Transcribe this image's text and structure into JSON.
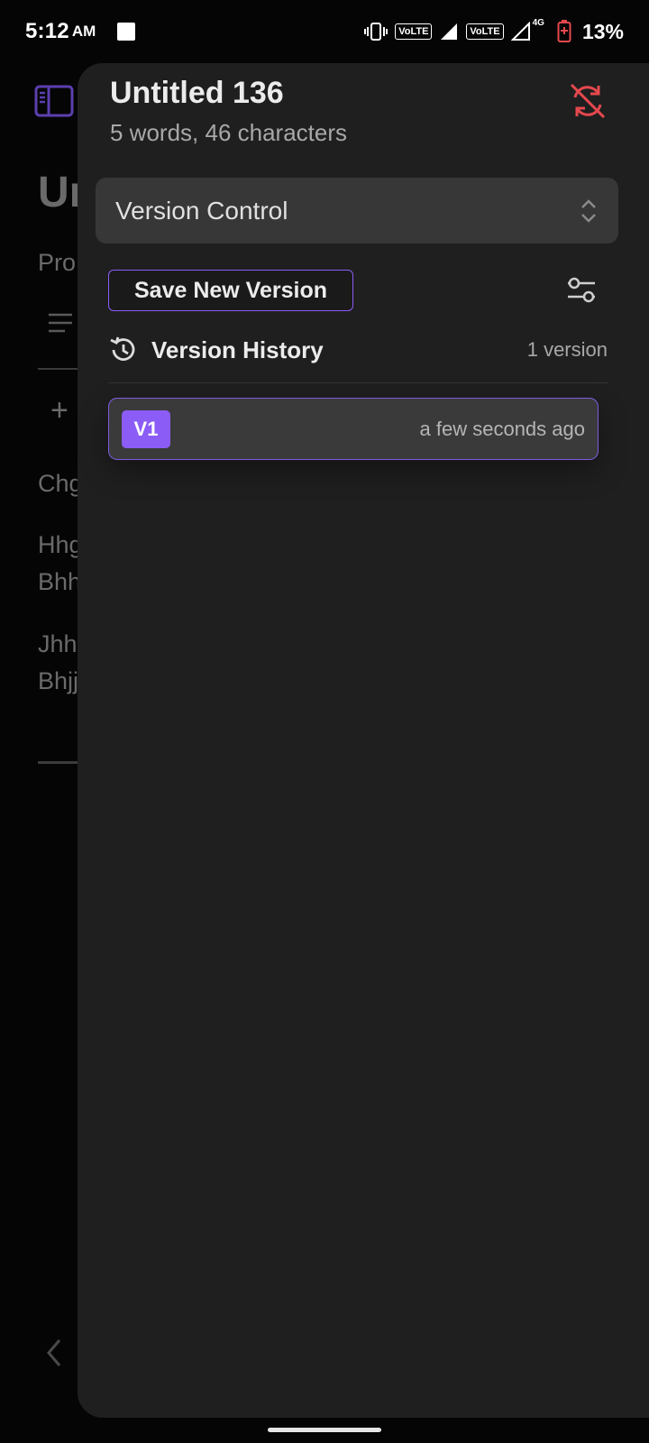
{
  "status_bar": {
    "time": "5:12",
    "ampm": "AM",
    "volte1": "VoLTE",
    "volte2": "VoLTE",
    "net": "4G",
    "battery": "13%"
  },
  "background_doc": {
    "title_fragment": "Un",
    "subtitle_fragment": "Pro",
    "plus": "+",
    "lines": [
      "Chg",
      "Hhg",
      "Bhh",
      "Jhh",
      "Bhjj"
    ]
  },
  "panel": {
    "title": "Untitled 136",
    "stats": "5 words, 46 characters",
    "select_value": "Version Control",
    "save_button": "Save New Version",
    "history_title": "Version History",
    "history_count": "1 version",
    "versions": [
      {
        "label": "V1",
        "time": "a few seconds ago"
      }
    ]
  },
  "colors": {
    "accent": "#8b5cf6",
    "sync_error": "#e5484d",
    "panel_bg": "#1f1f1f"
  },
  "icons": {
    "sidebar": "sidebar-toggle-icon",
    "sync": "sync-off-icon",
    "select": "chevron-up-down-icon",
    "filter": "sliders-icon",
    "history": "history-icon",
    "back": "chevron-left-icon"
  }
}
